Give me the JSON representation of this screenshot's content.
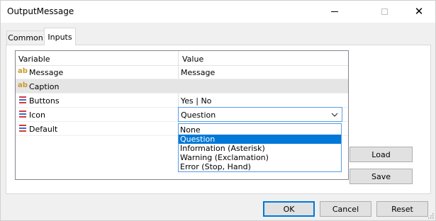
{
  "window": {
    "title": "OutputMessage"
  },
  "titlebar": {
    "minimize_icon": "minimize-icon",
    "maximize_icon": "maximize-icon",
    "close_icon": "close-icon",
    "close_glyph": "✕"
  },
  "tabs": [
    {
      "label": "Common",
      "active": false
    },
    {
      "label": "Inputs",
      "active": true
    }
  ],
  "grid": {
    "headers": {
      "variable": "Variable",
      "value": "Value"
    },
    "rows": [
      {
        "icon": "string-type-icon",
        "glyph": "ab",
        "name": "Message",
        "value": "Message"
      },
      {
        "icon": "string-type-icon",
        "glyph": "ab",
        "name": "Caption",
        "value": ""
      },
      {
        "icon": "enum-type-icon",
        "name": "Buttons",
        "value": "Yes | No"
      },
      {
        "icon": "enum-type-icon",
        "name": "Icon",
        "value": "Question"
      },
      {
        "icon": "enum-type-icon",
        "name": "Default",
        "value": ""
      }
    ]
  },
  "combo": {
    "selected": "Question",
    "arrow_icon": "chevron-down-icon"
  },
  "dropdown": {
    "options": [
      "None",
      "Question",
      "Information (Asterisk)",
      "Warning (Exclamation)",
      "Error (Stop, Hand)"
    ],
    "highlighted": "Question"
  },
  "side_buttons": {
    "load": "Load",
    "save": "Save"
  },
  "footer": {
    "ok": "OK",
    "cancel": "Cancel",
    "reset": "Reset"
  },
  "colors": {
    "accent": "#0078d7",
    "selection": "#0078d7",
    "row_selected": "#e5e5e5",
    "string_icon": "#c99a28"
  }
}
